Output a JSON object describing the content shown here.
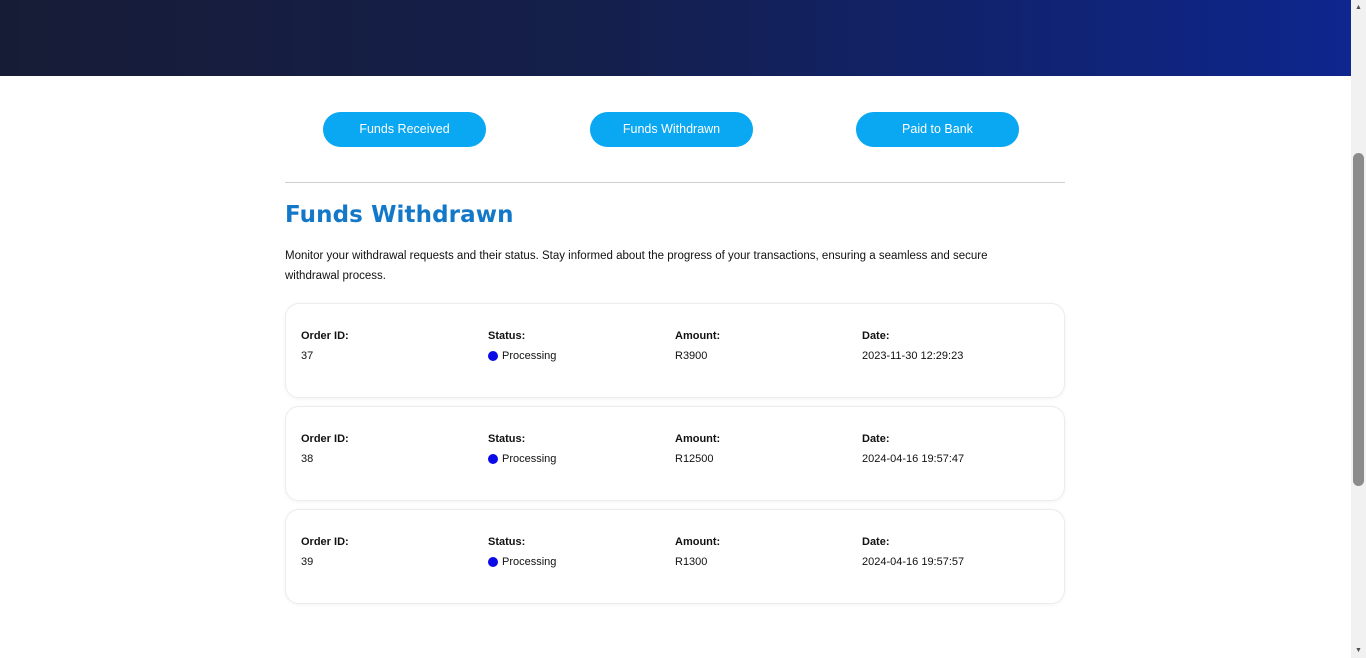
{
  "tabs": [
    {
      "label": "Funds Received"
    },
    {
      "label": "Funds Withdrawn"
    },
    {
      "label": "Paid to Bank"
    }
  ],
  "section": {
    "title": "Funds Withdrawn",
    "description": "Monitor your withdrawal requests and their status. Stay informed about the progress of your transactions, ensuring a seamless and secure withdrawal process."
  },
  "labels": {
    "order_id": "Order ID:",
    "status": "Status:",
    "amount": "Amount:",
    "date": "Date:"
  },
  "orders": [
    {
      "order_id": "37",
      "status": "Processing",
      "amount": "R3900",
      "date": "2023-11-30 12:29:23"
    },
    {
      "order_id": "38",
      "status": "Processing",
      "amount": "R12500",
      "date": "2024-04-16 19:57:47"
    },
    {
      "order_id": "39",
      "status": "Processing",
      "amount": "R1300",
      "date": "2024-04-16 19:57:57"
    }
  ],
  "colors": {
    "accent": "#0aa7f2",
    "title": "#1478c8",
    "status_processing": "#0a0ae6",
    "banner_start": "#171c36",
    "banner_end": "#0e268e"
  },
  "icons": {
    "status": "status-dot-icon",
    "scroll_up": "scroll-up-arrow-icon",
    "scroll_down": "scroll-down-arrow-icon"
  }
}
